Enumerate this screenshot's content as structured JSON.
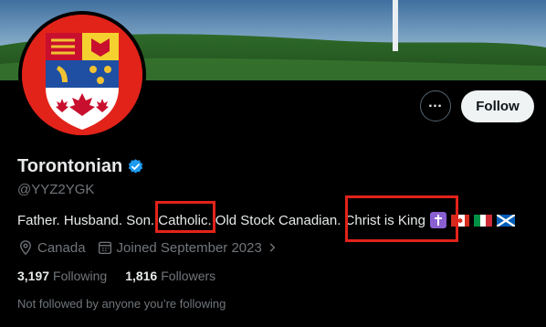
{
  "profile": {
    "display_name": "Torontonian",
    "handle": "@YYZ2YGK",
    "verified": true,
    "verified_color": "#1d9bf0"
  },
  "actions": {
    "more_icon": "more-horizontal-icon",
    "follow_label": "Follow"
  },
  "bio": {
    "parts": [
      "Father. Husband. Son. ",
      "Catholic.",
      " Old Stock Canadian. ",
      "Christ is King"
    ],
    "emojis": [
      "latin-cross-emoji",
      "canada-flag-emoji",
      "italy-flag-emoji",
      "scotland-flag-emoji"
    ],
    "highlight_color": "#e2231a"
  },
  "meta": {
    "location": "Canada",
    "joined": "Joined September 2023"
  },
  "stats": {
    "following_count": "3,197",
    "following_label": "Following",
    "followers_count": "1,816",
    "followers_label": "Followers"
  },
  "footer_note": "Not followed by anyone you’re following"
}
